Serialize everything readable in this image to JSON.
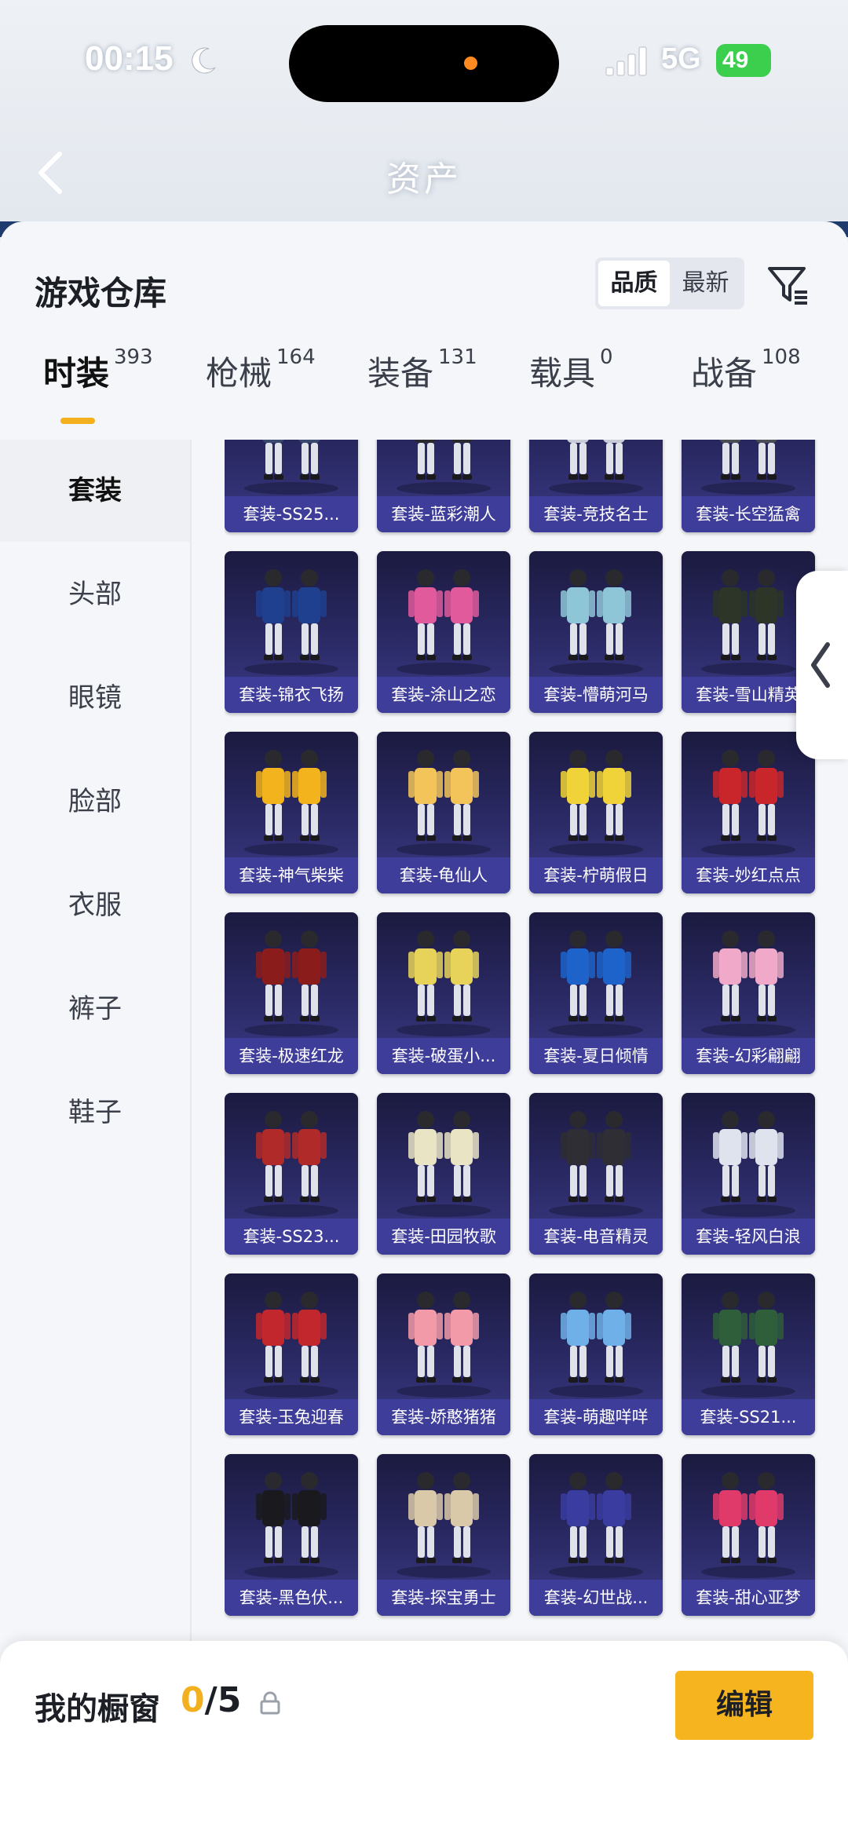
{
  "status_bar": {
    "time": "00:15",
    "network": "5G",
    "battery": "49"
  },
  "nav": {
    "title": "资产"
  },
  "sheet": {
    "title": "游戏仓库",
    "sort_options": [
      "品质",
      "最新"
    ],
    "sort_active": "品质"
  },
  "tabs": [
    {
      "label": "时装",
      "count": "393"
    },
    {
      "label": "枪械",
      "count": "164"
    },
    {
      "label": "装备",
      "count": "131"
    },
    {
      "label": "载具",
      "count": "0"
    },
    {
      "label": "战备",
      "count": "108"
    }
  ],
  "categories": [
    "套装",
    "头部",
    "眼镜",
    "脸部",
    "衣服",
    "裤子",
    "鞋子"
  ],
  "items": [
    [
      "套装-SS25...",
      "套装-蓝彩潮人",
      "套装-竞技名士",
      "套装-长空猛禽"
    ],
    [
      "套装-锦衣飞扬",
      "套装-涂山之恋",
      "套装-懵萌河马",
      "套装-雪山精英"
    ],
    [
      "套装-神气柴柴",
      "套装-龟仙人",
      "套装-柠萌假日",
      "套装-妙红点点"
    ],
    [
      "套装-极速红龙",
      "套装-破蛋小...",
      "套装-夏日倾情",
      "套装-幻彩翩翩"
    ],
    [
      "套装-SS23...",
      "套装-田园牧歌",
      "套装-电音精灵",
      "套装-轻风白浪"
    ],
    [
      "套装-玉兔迎春",
      "套装-娇憨猪猪",
      "套装-萌趣咩咩",
      "套装-SS21..."
    ],
    [
      "套装-黑色伏...",
      "套装-探宝勇士",
      "套装-幻世战...",
      "套装-甜心亚梦"
    ]
  ],
  "outfit_colors": [
    [
      "#3a4a6e",
      "#2a2a2e",
      "#c9ccd6",
      "#4b4f55"
    ],
    [
      "#1f3f8f",
      "#e05a9c",
      "#8ec6d8",
      "#2c3527"
    ],
    [
      "#f2b31d",
      "#f2c45a",
      "#f0d338",
      "#c8262b"
    ],
    [
      "#8b1c1c",
      "#e8d35a",
      "#1d63c9",
      "#f0a9c9"
    ],
    [
      "#b02a2a",
      "#e9e4c4",
      "#2e2e34",
      "#dfe3ee"
    ],
    [
      "#c2272d",
      "#f29aa8",
      "#6fb0e8",
      "#2f5e3a"
    ],
    [
      "#1a1a1e",
      "#d9c9a8",
      "#3a3ca0",
      "#e03a6a"
    ]
  ],
  "showcase": {
    "label": "我的橱窗",
    "current": "0",
    "total": "/5",
    "edit_label": "编辑"
  },
  "colors": {
    "accent": "#f6b51f",
    "card_label": "#3f3d9a"
  }
}
